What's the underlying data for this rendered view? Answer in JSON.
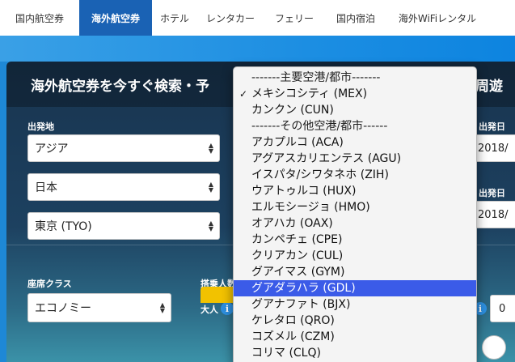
{
  "nav": {
    "tabs": [
      {
        "label": "国内航空券",
        "active": false
      },
      {
        "label": "海外航空券",
        "active": true
      },
      {
        "label": "ホテル",
        "active": false
      },
      {
        "label": "レンタカー",
        "active": false
      },
      {
        "label": "フェリー",
        "active": false
      },
      {
        "label": "国内宿泊",
        "active": false
      },
      {
        "label": "海外WiFiレンタル",
        "active": false
      }
    ]
  },
  "search": {
    "title": "海外航空券を今すぐ検索・予",
    "title_right": "周遊",
    "departure_label": "出発地",
    "region": "アジア",
    "country": "日本",
    "city": "東京 (TYO)",
    "depart_date_label": "出発日",
    "depart_date_value": "2018/",
    "return_date_label": "出発日",
    "return_date_value": "2018/",
    "seat_class_label": "座席クラス",
    "seat_class_value": "エコノミー",
    "passengers_label": "搭乗人数",
    "adult_label": "大人",
    "child_count": "0"
  },
  "dropdown": {
    "options": [
      {
        "text": "-------主要空港/都市-------",
        "type": "header",
        "checked": false,
        "highlighted": false
      },
      {
        "text": "メキシコシティ (MEX)",
        "type": "option",
        "checked": true,
        "highlighted": false
      },
      {
        "text": "カンクン (CUN)",
        "type": "option",
        "checked": false,
        "highlighted": false
      },
      {
        "text": "-------その他空港/都市------",
        "type": "header",
        "checked": false,
        "highlighted": false
      },
      {
        "text": "アカプルコ (ACA)",
        "type": "option",
        "checked": false,
        "highlighted": false
      },
      {
        "text": "アグアスカリエンテス (AGU)",
        "type": "option",
        "checked": false,
        "highlighted": false
      },
      {
        "text": "イスパタ/シワタネホ (ZIH)",
        "type": "option",
        "checked": false,
        "highlighted": false
      },
      {
        "text": "ウアトゥルコ (HUX)",
        "type": "option",
        "checked": false,
        "highlighted": false
      },
      {
        "text": "エルモシージョ (HMO)",
        "type": "option",
        "checked": false,
        "highlighted": false
      },
      {
        "text": "オアハカ (OAX)",
        "type": "option",
        "checked": false,
        "highlighted": false
      },
      {
        "text": "カンペチェ (CPE)",
        "type": "option",
        "checked": false,
        "highlighted": false
      },
      {
        "text": "クリアカン (CUL)",
        "type": "option",
        "checked": false,
        "highlighted": false
      },
      {
        "text": "グアイマス (GYM)",
        "type": "option",
        "checked": false,
        "highlighted": false
      },
      {
        "text": "グアダラハラ (GDL)",
        "type": "option",
        "checked": false,
        "highlighted": true
      },
      {
        "text": "グアナファト (BJX)",
        "type": "option",
        "checked": false,
        "highlighted": false
      },
      {
        "text": "ケレタロ (QRO)",
        "type": "option",
        "checked": false,
        "highlighted": false
      },
      {
        "text": "コズメル (CZM)",
        "type": "option",
        "checked": false,
        "highlighted": false
      },
      {
        "text": "コリマ (CLQ)",
        "type": "option",
        "checked": false,
        "highlighted": false
      }
    ]
  }
}
